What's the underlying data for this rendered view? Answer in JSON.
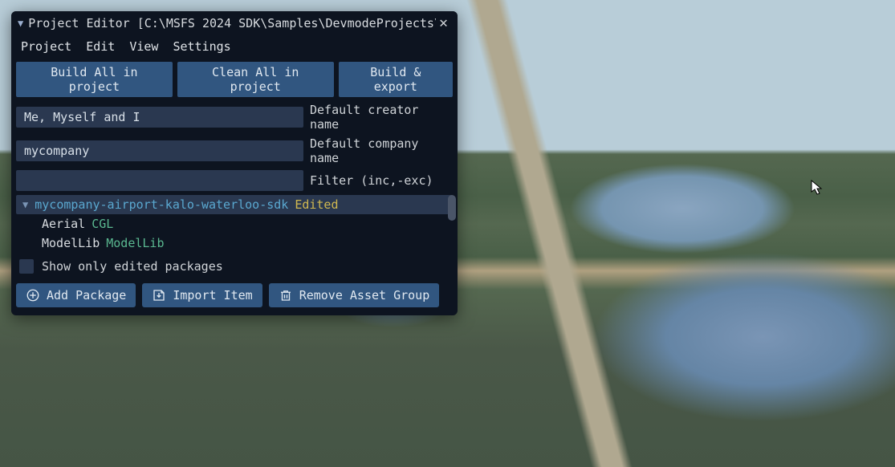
{
  "window": {
    "title": "Project Editor [C:\\MSFS 2024 SDK\\Samples\\DevmodeProjects\\"
  },
  "menu": {
    "project": "Project",
    "edit": "Edit",
    "view": "View",
    "settings": "Settings"
  },
  "buttons": {
    "build_all": "Build All in project",
    "clean_all": "Clean All in project",
    "build_export": "Build & export"
  },
  "fields": {
    "creator_value": "Me, Myself and I",
    "creator_label": "Default creator name",
    "company_value": "mycompany",
    "company_label": "Default company name",
    "filter_value": "",
    "filter_label": "Filter (inc,-exc)"
  },
  "tree": {
    "package": {
      "name": "mycompany-airport-kalo-waterloo-sdk",
      "status": "Edited"
    },
    "items": [
      {
        "name": "Aerial",
        "type": "CGL"
      },
      {
        "name": "ModelLib",
        "type": "ModelLib"
      }
    ]
  },
  "checkbox": {
    "show_edited": "Show only edited packages"
  },
  "actions": {
    "add_package": "Add Package",
    "import_item": "Import Item",
    "remove_group": "Remove Asset Group"
  }
}
